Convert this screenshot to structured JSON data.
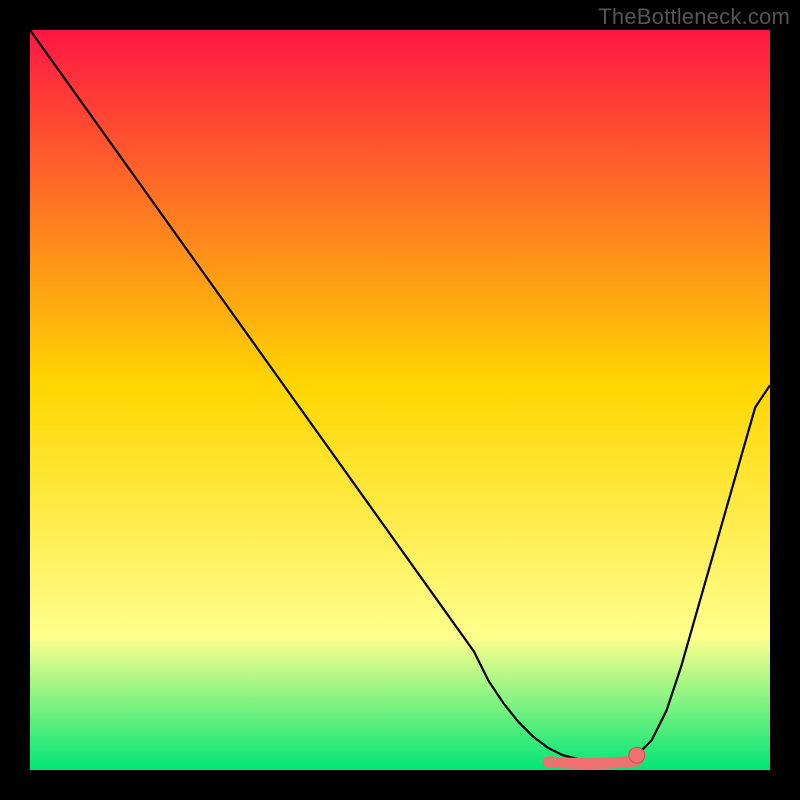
{
  "watermark": "TheBottleneck.com",
  "colors": {
    "bg": "#000000",
    "grad_top": "#ff1744",
    "grad_mid": "#ffd600",
    "grad_low": "#ffff8d",
    "grad_bottom": "#00e676",
    "curve": "#000000",
    "marker_fill": "#ef7070",
    "marker_stroke": "#d05050"
  },
  "chart_data": {
    "type": "line",
    "title": "",
    "xlabel": "",
    "ylabel": "",
    "xlim": [
      0,
      100
    ],
    "ylim": [
      0,
      100
    ],
    "x": [
      0,
      5,
      10,
      15,
      20,
      25,
      30,
      35,
      40,
      45,
      50,
      55,
      60,
      62,
      64,
      66,
      68,
      70,
      72,
      74,
      76,
      78,
      80,
      82,
      84,
      86,
      88,
      90,
      92,
      94,
      96,
      98,
      100
    ],
    "values": [
      100,
      93,
      86,
      79,
      72,
      65,
      58,
      51,
      44,
      37,
      30,
      23,
      16,
      12,
      9,
      6.5,
      4.5,
      3,
      2,
      1.5,
      1,
      1,
      1.2,
      2,
      4,
      8,
      14,
      21,
      28,
      35,
      42,
      49,
      52
    ],
    "flat_region_x": [
      70,
      82
    ],
    "marker_x": 82,
    "marker_y": 2
  }
}
